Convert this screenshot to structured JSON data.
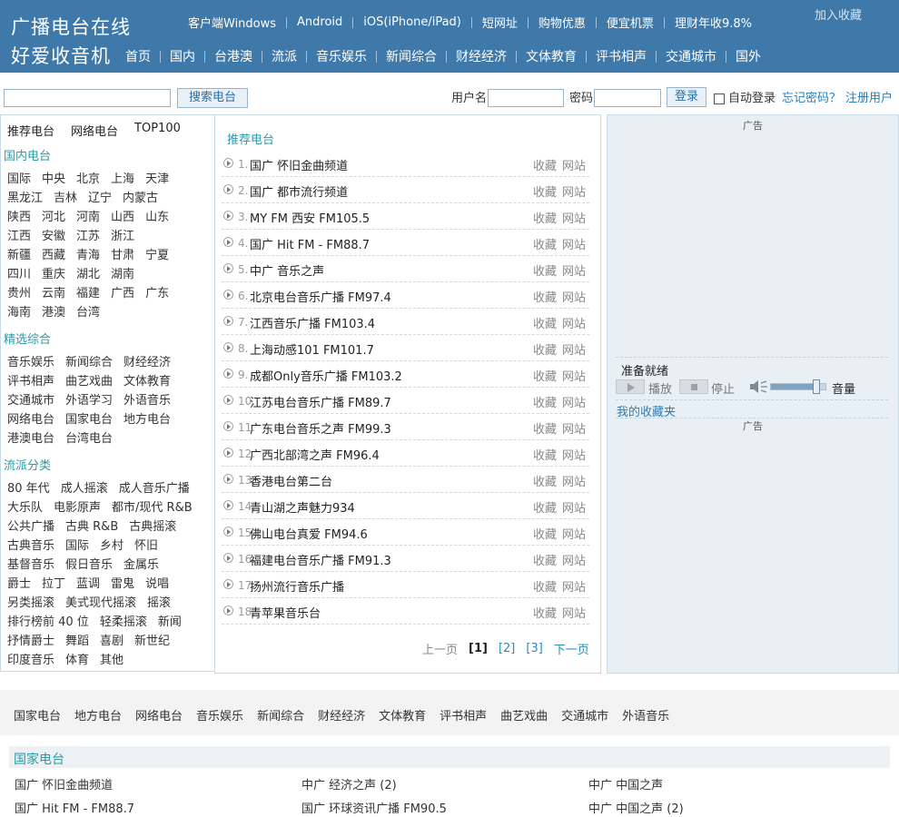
{
  "header": {
    "brand_line1": "广播电台在线",
    "brand_line2": "好爱收音机",
    "add_favorite": "加入收藏",
    "top_links": [
      "客户端Windows",
      "Android",
      "iOS(iPhone/iPad)",
      "短网址",
      "购物优惠",
      "便宜机票",
      "理财年收9.8%"
    ],
    "nav": [
      "首页",
      "国内",
      "台港澳",
      "流派",
      "音乐娱乐",
      "新闻综合",
      "财经经济",
      "文体教育",
      "评书相声",
      "交通城市",
      "国外"
    ]
  },
  "search": {
    "input_value": "",
    "button": "搜索电台",
    "username_label": "用户名",
    "password_label": "密码",
    "login_button": "登录",
    "auto_login": "自动登录",
    "forgot": "忘记密码？",
    "register": "注册用户"
  },
  "left": {
    "tabs": [
      "推荐电台",
      "网络电台",
      "TOP100"
    ],
    "domestic_title": "国内电台",
    "domestic_rows": [
      [
        "国际",
        "中央",
        "北京",
        "上海",
        "天津"
      ],
      [
        "黑龙江",
        "吉林",
        "辽宁",
        "内蒙古"
      ],
      [
        "陕西",
        "河北",
        "河南",
        "山西",
        "山东"
      ],
      [
        "江西",
        "安徽",
        "江苏",
        "浙江"
      ],
      [
        "新疆",
        "西藏",
        "青海",
        "甘肃",
        "宁夏"
      ],
      [
        "四川",
        "重庆",
        "湖北",
        "湖南"
      ],
      [
        "贵州",
        "云南",
        "福建",
        "广西",
        "广东"
      ],
      [
        "海南",
        "港澳",
        "台湾"
      ]
    ],
    "select_title": "精选综合",
    "select_rows": [
      [
        "音乐娱乐",
        "新闻综合",
        "财经经济"
      ],
      [
        "评书相声",
        "曲艺戏曲",
        "文体教育"
      ],
      [
        "交通城市",
        "外语学习",
        "外语音乐"
      ],
      [
        "网络电台",
        "国家电台",
        "地方电台"
      ],
      [
        "港澳电台",
        "台湾电台"
      ]
    ],
    "genre_title": "流派分类",
    "genre_rows": [
      [
        "80 年代",
        "成人摇滚",
        "成人音乐广播"
      ],
      [
        "大乐队",
        "电影原声",
        "都市/现代 R&B"
      ],
      [
        "公共广播",
        "古典 R&B",
        "古典摇滚"
      ],
      [
        "古典音乐",
        "国际",
        "乡村",
        "怀旧"
      ],
      [
        "基督音乐",
        "假日音乐",
        "金属乐"
      ],
      [
        "爵士",
        "拉丁",
        "蓝调",
        "雷鬼",
        "说唱"
      ],
      [
        "另类摇滚",
        "美式现代摇滚",
        "摇滚"
      ],
      [
        "排行榜前 40 位",
        "轻柔摇滚",
        "新闻"
      ],
      [
        "抒情爵士",
        "舞蹈",
        "喜剧",
        "新世纪"
      ],
      [
        "印度音乐",
        "体育",
        "其他"
      ]
    ]
  },
  "center": {
    "title": "推荐电台",
    "fav_label": "收藏",
    "site_label": "网站",
    "stations": [
      {
        "num": "1.",
        "name": "国广 怀旧金曲频道"
      },
      {
        "num": "2.",
        "name": "国广 都市流行频道"
      },
      {
        "num": "3.",
        "name": "MY FM 西安 FM105.5"
      },
      {
        "num": "4.",
        "name": "国广 Hit FM - FM88.7"
      },
      {
        "num": "5.",
        "name": "中广 音乐之声"
      },
      {
        "num": "6.",
        "name": "北京电台音乐广播 FM97.4"
      },
      {
        "num": "7.",
        "name": "江西音乐广播 FM103.4"
      },
      {
        "num": "8.",
        "name": "上海动感101 FM101.7"
      },
      {
        "num": "9.",
        "name": "成都Only音乐广播 FM103.2"
      },
      {
        "num": "10.",
        "name": "江苏电台音乐广播 FM89.7"
      },
      {
        "num": "11.",
        "name": "广东电台音乐之声 FM99.3"
      },
      {
        "num": "12.",
        "name": "广西北部湾之声 FM96.4"
      },
      {
        "num": "13.",
        "name": "香港电台第二台"
      },
      {
        "num": "14.",
        "name": "青山湖之声魅力934"
      },
      {
        "num": "15.",
        "name": "佛山电台真爱 FM94.6"
      },
      {
        "num": "16.",
        "name": "福建电台音乐广播 FM91.3"
      },
      {
        "num": "17.",
        "name": "扬州流行音乐广播"
      },
      {
        "num": "18.",
        "name": "青苹果音乐台"
      }
    ],
    "pager": {
      "prev": "上一页",
      "current": "[1]",
      "p2": "[2]",
      "p3": "[3]",
      "next": "下一页"
    }
  },
  "right": {
    "ad1": "广告",
    "ready": "准备就绪",
    "play": "播放",
    "stop": "停止",
    "volume": "音量",
    "volume_level": 0.85,
    "favorites_title": "我的收藏夹",
    "ad2": "广告"
  },
  "footer": {
    "links": [
      "国家电台",
      "地方电台",
      "网络电台",
      "音乐娱乐",
      "新闻综合",
      "财经经济",
      "文体教育",
      "评书相声",
      "曲艺戏曲",
      "交通城市",
      "外语音乐"
    ],
    "national_title": "国家电台",
    "national_items": [
      "国广 怀旧金曲频道",
      "中广 经济之声 (2)",
      "中广 中国之声",
      "国广 Hit FM - FM88.7",
      "国广 环球资讯广播 FM90.5",
      "中广 中国之声 (2)"
    ]
  },
  "colors": {
    "header_bg": "#3f79aa",
    "accent": "#2a9aa6",
    "link": "#2a7dbb",
    "right_bg": "#e8f0f5"
  }
}
